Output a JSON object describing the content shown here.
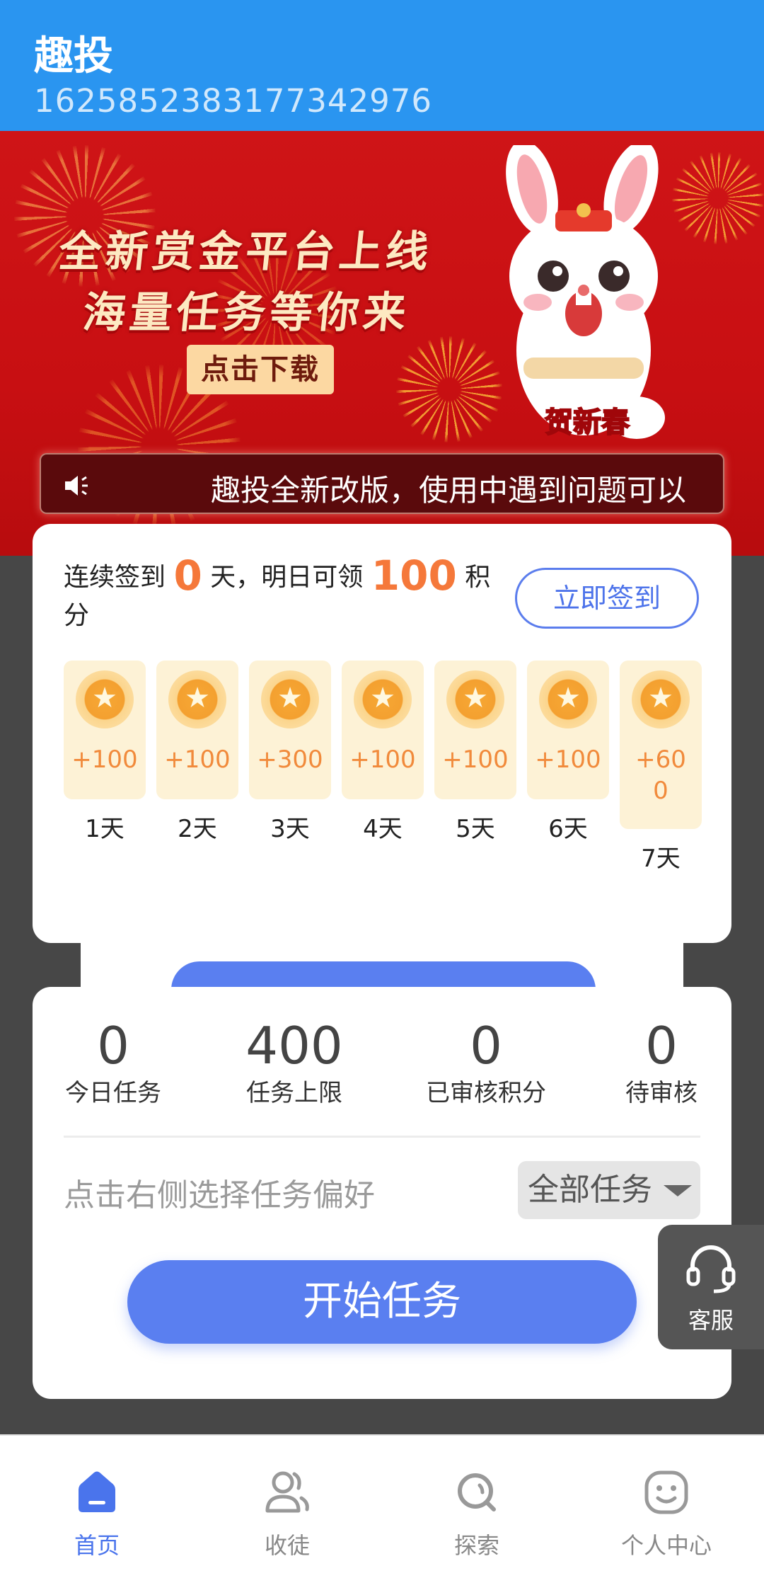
{
  "header": {
    "title": "趣投",
    "user_id": "1625852383177342976"
  },
  "banner": {
    "line1": "全新赏金平台上线",
    "line2": "海量任务等你来",
    "cta": "点击下载",
    "badge": "贺新春"
  },
  "notice": {
    "text": "趣投全新改版，使用中遇到问题可以"
  },
  "signin": {
    "prefix": "连续签到",
    "days_count": "0",
    "middle": "天，明日可领",
    "points": "100",
    "suffix": "积分",
    "button": "立即签到",
    "days": [
      {
        "pts": "+100",
        "label": "1天"
      },
      {
        "pts": "+100",
        "label": "2天"
      },
      {
        "pts": "+300",
        "label": "3天"
      },
      {
        "pts": "+100",
        "label": "4天"
      },
      {
        "pts": "+100",
        "label": "5天"
      },
      {
        "pts": "+100",
        "label": "6天"
      },
      {
        "pts": "+600",
        "label": "7天"
      }
    ]
  },
  "stats": {
    "items": [
      {
        "value": "0",
        "label": "今日任务"
      },
      {
        "value": "400",
        "label": "任务上限"
      },
      {
        "value": "0",
        "label": "已审核积分"
      },
      {
        "value": "0",
        "label": "待审核"
      }
    ],
    "pref_hint": "点击右侧选择任务偏好",
    "select_value": "全部任务",
    "start_button": "开始任务"
  },
  "service": {
    "label": "客服"
  },
  "tabbar": {
    "items": [
      {
        "label": "首页",
        "icon": "home-icon",
        "active": true
      },
      {
        "label": "收徒",
        "icon": "users-icon",
        "active": false
      },
      {
        "label": "探索",
        "icon": "search-icon",
        "active": false
      },
      {
        "label": "个人中心",
        "icon": "face-icon",
        "active": false
      }
    ]
  },
  "colors": {
    "primary": "#2a95f0",
    "accent": "#5a7ff0",
    "highlight": "#f5783a",
    "banner_red": "#cf1417"
  }
}
